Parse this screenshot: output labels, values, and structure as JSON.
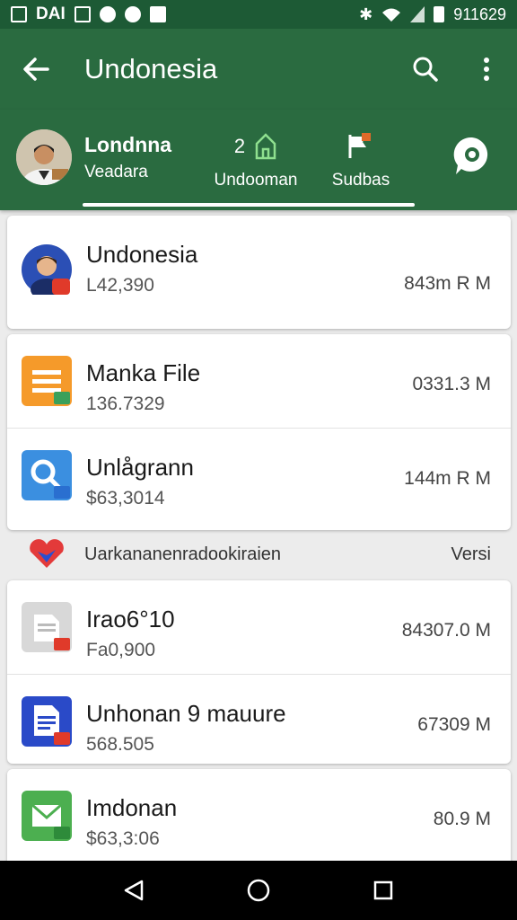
{
  "status_bar": {
    "carrier": "DAI",
    "time": "911629"
  },
  "app_bar": {
    "title": "Undonesia",
    "icons": [
      "back-arrow-icon",
      "search-icon",
      "more-vert-icon"
    ]
  },
  "tabs": {
    "profile_name": "Londnna",
    "profile_sub": "Veadara",
    "tab1_badge": "2",
    "tab1_label": "Undooman",
    "tab2_label": "Sudbas"
  },
  "items_card1": [
    {
      "title": "Undonesia",
      "sub": "L42,390",
      "size": "843m R M",
      "icon": "avatar"
    }
  ],
  "items_card2": [
    {
      "title": "Manka File",
      "sub": "136.7329",
      "size": "0331.3 M",
      "icon": "file-orange-icon"
    },
    {
      "title": "Unlågrann",
      "sub": "$63,3014",
      "size": "144m R M",
      "icon": "search-blue-icon"
    }
  ],
  "section": {
    "text": "Uarkananenradookiraien",
    "right": "Versi"
  },
  "items_card3": [
    {
      "title": "Irao6°10",
      "sub": "Fa0,900",
      "size": "84307.0 M",
      "icon": "doc-gray-icon"
    },
    {
      "title": "Unhonan 9  mauure",
      "sub": "568.505",
      "size": "67309 M",
      "icon": "doc-blue-icon"
    }
  ],
  "items_card4": [
    {
      "title": "Imdonan",
      "sub": "$63,3:06",
      "size": "80.9 M",
      "icon": "mail-green-icon"
    }
  ],
  "colors": {
    "primary": "#2a6b40",
    "status": "#1d5a35"
  }
}
